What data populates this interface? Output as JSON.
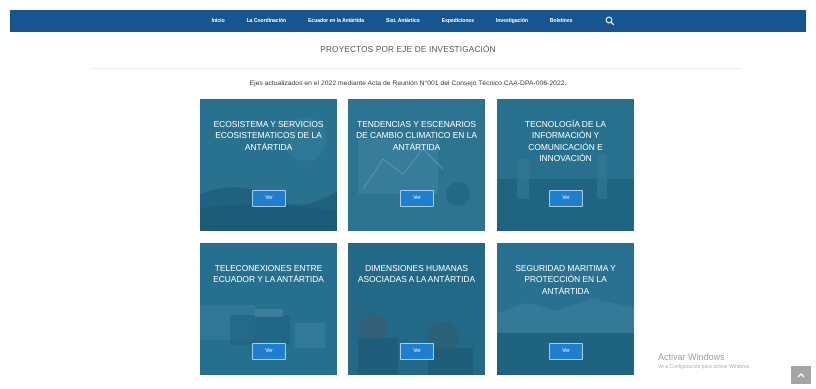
{
  "nav": {
    "items": [
      "Inicio",
      "La Coordinación",
      "Ecuador en la Antártida",
      "Sist. Antártico",
      "Expediciones",
      "Investigación",
      "Boletines"
    ],
    "search_icon": "search-icon",
    "bar_color": "#16558f"
  },
  "page": {
    "title": "PROYECTOS POR EJE DE INVESTIGACIÓN",
    "subtitle": "Ejes actualizados en el 2022 mediante Acta de Reunión N°001 del Consejo Técnico CAA-DPA-006-2022."
  },
  "cards": [
    {
      "title": "ECOSISTEMA Y SERVICIOS ECOSISTEMATICOS DE LA ANTÁRTIDA",
      "button": "Ver"
    },
    {
      "title": "TENDENCIAS Y ESCENARIOS DE CAMBIO CLIMATICO EN LA ANTÁRTIDA",
      "button": "Ver"
    },
    {
      "title": "TECNOLOGÍA DE LA INFORMACIÓN Y COMUNICACIÓN E INNOVACIÓN",
      "button": "Ver"
    },
    {
      "title": "TELECONEXIONES ENTRE ECUADOR Y LA ANTÁRTIDA",
      "button": "Ver"
    },
    {
      "title": "DIMENSIONES HUMANAS ASOCIADAS A LA ANTÁRTIDA",
      "button": "Ver"
    },
    {
      "title": "SEGURIDAD MARITIMA Y PROTECCIÓN EN LA ANTÁRTIDA",
      "button": "Ver"
    }
  ],
  "watermark": {
    "line1": "Activar Windows",
    "line2": "Ve a Configuración para activar Windows."
  },
  "colors": {
    "card_overlay": "#16688c",
    "button": "#1e7fd0"
  }
}
